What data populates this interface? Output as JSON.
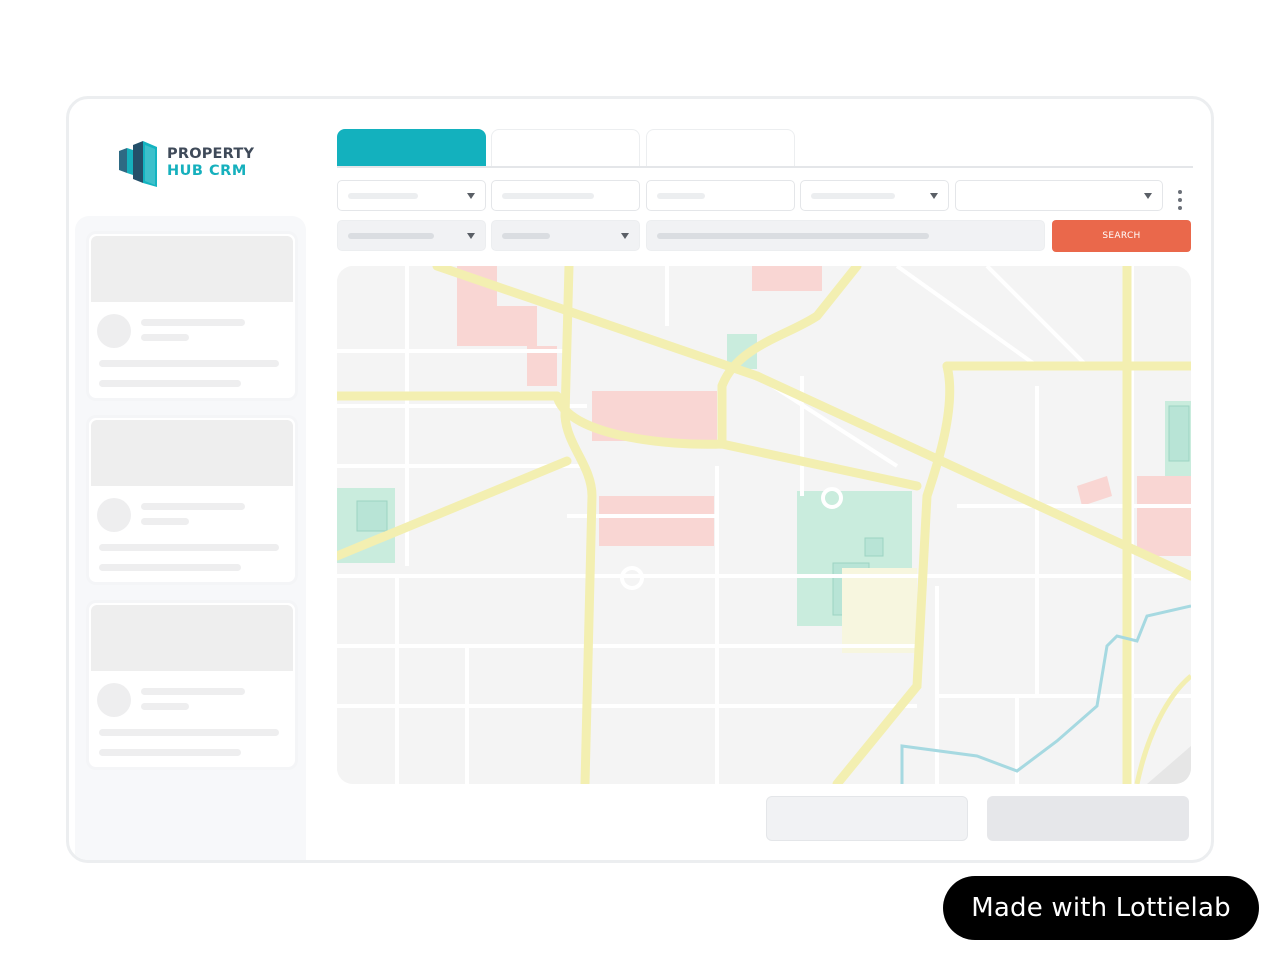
{
  "app": {
    "logo_line1": "PROPERTY",
    "logo_line2": "HUB CRM"
  },
  "search": {
    "button_label": "SEARCH"
  },
  "badge": {
    "label": "Made with Lottielab"
  },
  "colors": {
    "accent_teal": "#13b1be",
    "search_orange": "#ea684b",
    "logo_dark": "#3f4a59"
  },
  "icons": [
    "building-logo-icon",
    "chevron-down-icon",
    "more-vertical-icon"
  ]
}
